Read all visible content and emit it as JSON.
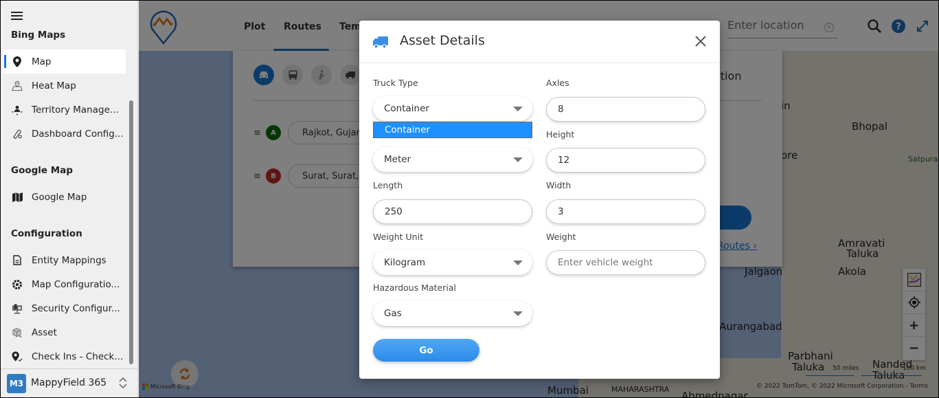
{
  "sidebar": {
    "sections": [
      {
        "title": "Bing Maps"
      },
      {
        "title": "Google Map"
      },
      {
        "title": "Configuration"
      }
    ],
    "items": [
      {
        "label": "Map",
        "icon": "map-pin-icon",
        "active": true
      },
      {
        "label": "Heat Map",
        "icon": "heat-map-icon"
      },
      {
        "label": "Territory Manage...",
        "icon": "territory-icon"
      },
      {
        "label": "Dashboard Config...",
        "icon": "dashboard-config-icon"
      },
      {
        "label": "Google Map",
        "icon": "google-map-icon"
      },
      {
        "label": "Entity Mappings",
        "icon": "document-icon"
      },
      {
        "label": "Map Configuratio...",
        "icon": "gear-icon"
      },
      {
        "label": "Security Configur...",
        "icon": "security-icon"
      },
      {
        "label": "Asset",
        "icon": "asset-box-icon"
      },
      {
        "label": "Check Ins - Check...",
        "icon": "check-in-pin-icon"
      }
    ],
    "footer": {
      "badge": "M3",
      "org_name": "MappyField 365"
    }
  },
  "topbar": {
    "tabs": [
      {
        "label": "Plot"
      },
      {
        "label": "Routes",
        "active": true
      },
      {
        "label": "Tem"
      }
    ],
    "location_placeholder": "Enter location"
  },
  "route_panel": {
    "stops": [
      {
        "badge": "A",
        "value": "Rajkot, Gujar",
        "color": "#0a6e0a"
      },
      {
        "badge": "B",
        "value": "Surat, Surat,",
        "color": "#c0282d"
      }
    ],
    "partial_text": "ation",
    "routes_link": "Routes"
  },
  "map": {
    "labels": [
      "Bhopal",
      "Amravati",
      "Taluka",
      "Jalgaon",
      "Akola",
      "Aurangabad",
      "Parbhani",
      "Taluka",
      "Nanded",
      "Taluka",
      "Mumbai",
      "MAHARASHTRA",
      "Ahmednagar",
      "in",
      "ore"
    ],
    "park_label": "Satpura National Park",
    "scale_miles": "50 miles",
    "scale_km": "100 km",
    "copyright": "© 2022 TomTom, © 2022 Microsoft Corporation",
    "terms": "Terms",
    "attribution": "Microsoft Bing"
  },
  "modal": {
    "title": "Asset Details",
    "fields": {
      "truck_type": {
        "label": "Truck Type",
        "value": "Container",
        "options": [
          "Container"
        ]
      },
      "axles": {
        "label": "Axles",
        "value": "8"
      },
      "dimension_unit": {
        "label": "",
        "value": "Meter"
      },
      "height": {
        "label": "Height",
        "value": "12"
      },
      "length": {
        "label": "Length",
        "value": "250"
      },
      "width": {
        "label": "Width",
        "value": "3"
      },
      "weight_unit": {
        "label": "Weight Unit",
        "value": "Kilogram"
      },
      "weight": {
        "label": "Weight",
        "value": "",
        "placeholder": "Enter vehicle weight"
      },
      "hazardous_material": {
        "label": "Hazardous Material",
        "value": "Gas"
      }
    },
    "go_label": "Go",
    "accent": "#2c8ae8"
  }
}
